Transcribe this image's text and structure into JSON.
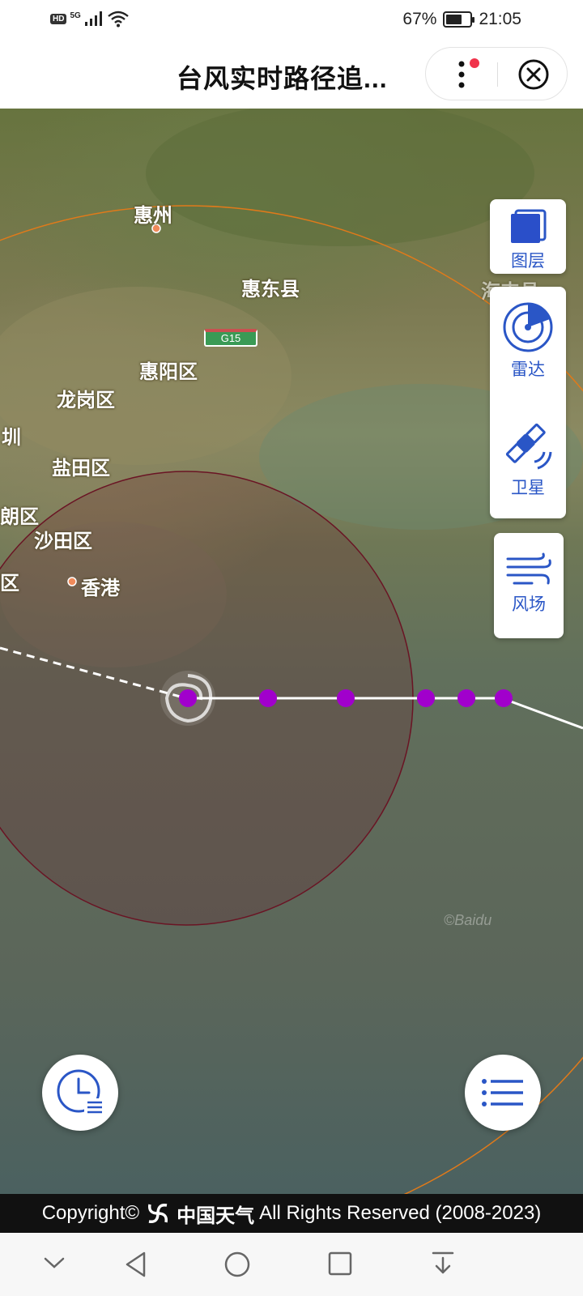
{
  "status_bar": {
    "hd": "HD",
    "network": "5G",
    "battery_percent": "67%",
    "battery_level": 0.67,
    "time": "21:05"
  },
  "title_bar": {
    "title": "台风实时路径追...",
    "more_icon": "more-vertical-icon",
    "close_icon": "close-circle-icon",
    "notification_dot_color": "#f0334b"
  },
  "map": {
    "place_labels": [
      "惠州",
      "惠东县",
      "惠阳区",
      "龙岗区",
      "圳",
      "盐田区",
      "朗区",
      "沙田区",
      "区",
      "香港",
      "海丰县"
    ],
    "road_label": "G15",
    "watermark": "©Baidu",
    "typhoon_icon": "typhoon-spiral-icon",
    "forecast_point_color": "#a100cc",
    "wind_circle_color": "#6a1424",
    "outer_circle_color": "#e07a1a"
  },
  "tools": {
    "layers": {
      "label": "图层",
      "icon": "layers-icon"
    },
    "radar": {
      "label": "雷达",
      "icon": "radar-icon"
    },
    "satellite": {
      "label": "卫星",
      "icon": "satellite-icon"
    },
    "wind": {
      "label": "风场",
      "icon": "wind-icon"
    },
    "accent_color": "#2a56c6"
  },
  "floating": {
    "history_icon": "clock-list-icon",
    "list_icon": "list-icon"
  },
  "footer": {
    "prefix": "Copyright©",
    "brand": "中国天气",
    "suffix": "All Rights Reserved (2008-2023)"
  },
  "nav_bar": {
    "icons": [
      "chevron-down-icon",
      "back-icon",
      "home-icon",
      "recent-apps-icon",
      "download-icon"
    ]
  }
}
